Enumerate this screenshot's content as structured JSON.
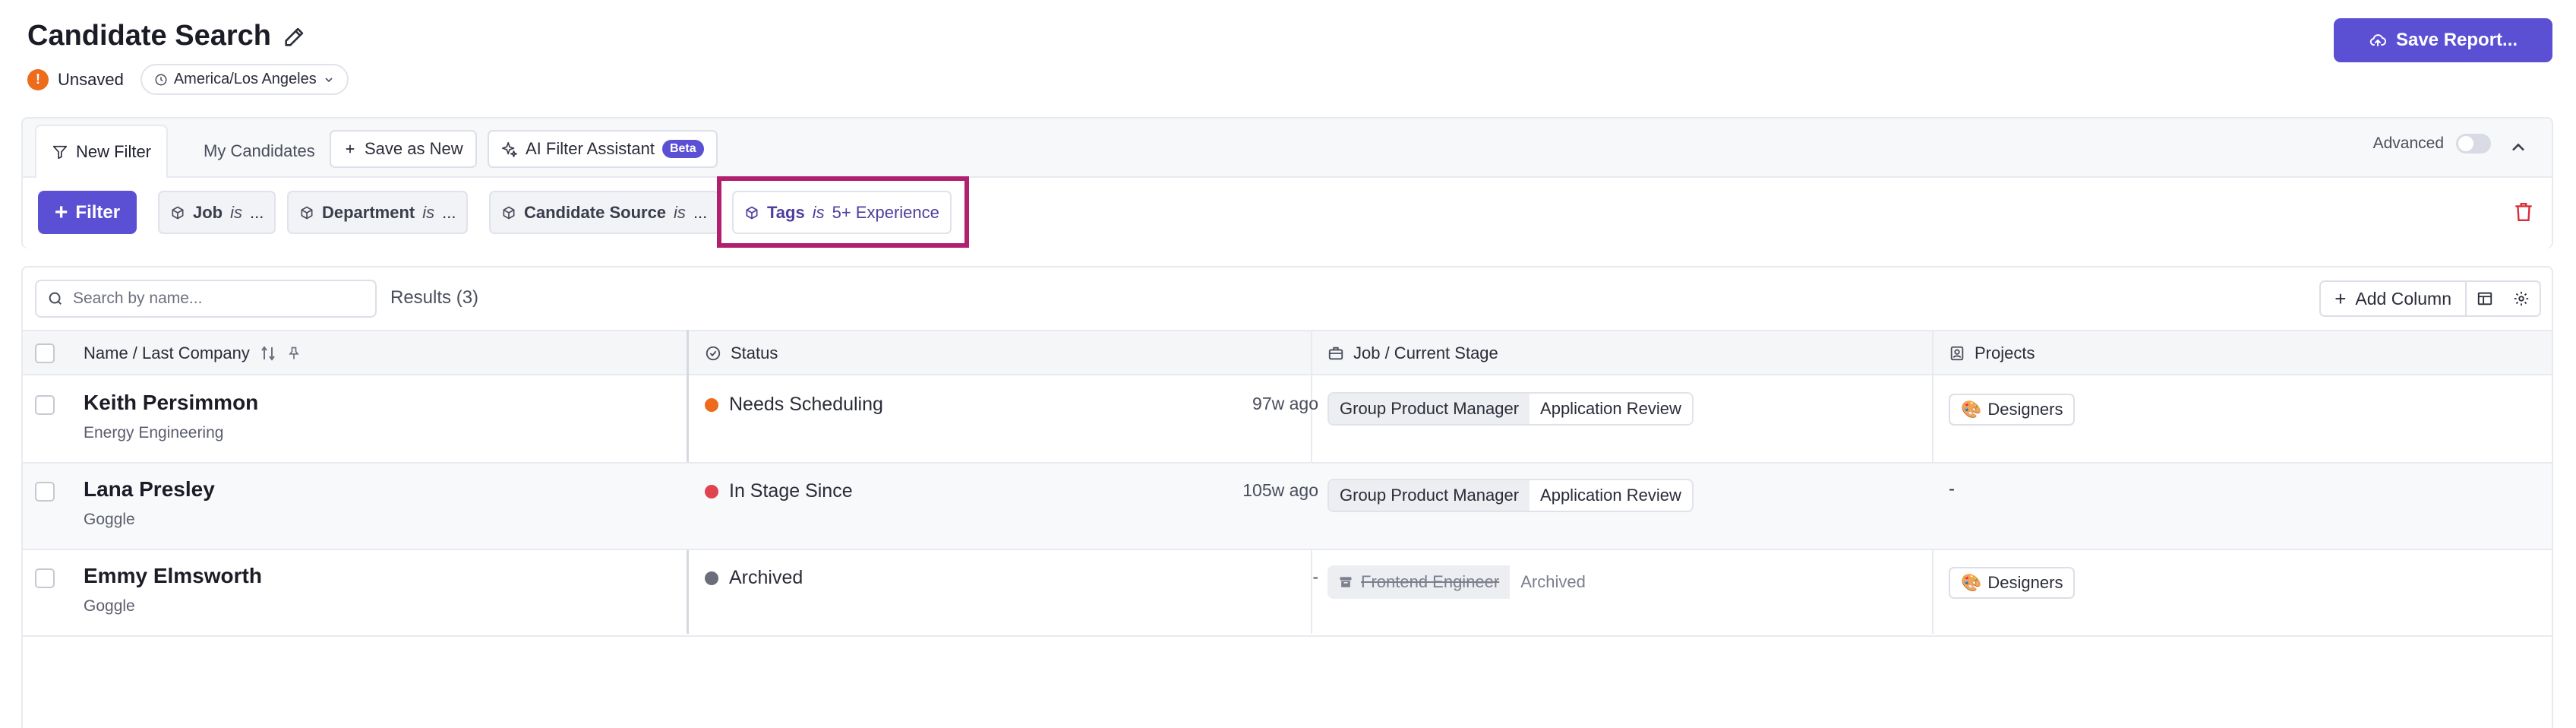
{
  "header": {
    "title": "Candidate Search",
    "status": "Unsaved",
    "timezone": "America/Los Angeles",
    "save_report_label": "Save Report..."
  },
  "filter_tabs": {
    "new_filter": "New Filter",
    "my_candidates": "My Candidates",
    "save_as_new": "Save as New",
    "ai_assistant": "AI Filter Assistant",
    "beta": "Beta",
    "advanced": "Advanced"
  },
  "filters": {
    "add_label": "Filter",
    "chips": [
      {
        "field": "Job",
        "op": "is",
        "value": "..."
      },
      {
        "field": "Department",
        "op": "is",
        "value": "..."
      },
      {
        "field": "Candidate Source",
        "op": "is",
        "value": "..."
      },
      {
        "field": "Tags",
        "op": "is",
        "value": "5+ Experience"
      }
    ]
  },
  "results": {
    "search_placeholder": "Search by name...",
    "count_label": "Results (3)",
    "add_column_label": "Add Column",
    "columns": {
      "name": "Name / Last Company",
      "status": "Status",
      "job": "Job / Current Stage",
      "projects": "Projects"
    },
    "rows": [
      {
        "name": "Keith Persimmon",
        "company": "Energy Engineering",
        "status": "Needs Scheduling",
        "status_color": "#ee6b1b",
        "elapsed": "97w ago",
        "job": "Group Product Manager",
        "stage": "Application Review",
        "project": "Designers",
        "archived": false
      },
      {
        "name": "Lana Presley",
        "company": "Goggle",
        "status": "In Stage Since",
        "status_color": "#e0444f",
        "elapsed": "105w ago",
        "job": "Group Product Manager",
        "stage": "Application Review",
        "project": "-",
        "archived": false
      },
      {
        "name": "Emmy Elmsworth",
        "company": "Goggle",
        "status": "Archived",
        "status_color": "#6b6e7a",
        "elapsed": "-",
        "job": "Frontend Engineer",
        "stage": "Archived",
        "project": "Designers",
        "archived": true
      }
    ]
  },
  "colors": {
    "accent": "#5b4fd4",
    "highlight": "#b11f6f",
    "warning": "#ee6b1b"
  }
}
